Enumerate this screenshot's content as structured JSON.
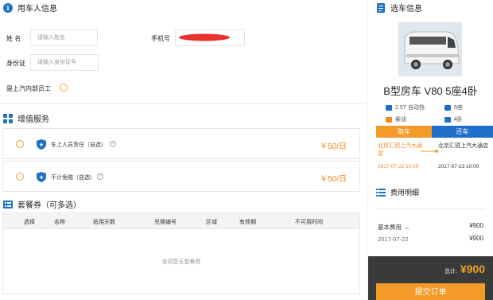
{
  "user_info": {
    "title": "用车人信息",
    "name_label": "姓  名",
    "name_placeholder": "请输入姓名",
    "phone_label": "手机号",
    "id_label": "身份证",
    "id_placeholder": "请输入身份证号",
    "employee_label": "是上汽内部员工"
  },
  "value_added": {
    "title": "增值服务",
    "items": [
      {
        "name": "车上人员责任（自选）",
        "price": "￥50/日"
      },
      {
        "name": "不计免赔（自选）",
        "price": "￥50/日"
      }
    ]
  },
  "coupons": {
    "title": "套餐券（可多选）",
    "columns": [
      "选择",
      "名称",
      "抵用天数",
      "兑换编号",
      "区域",
      "有效期",
      "不可用时间"
    ],
    "empty_text": "该项暂无套餐券"
  },
  "car": {
    "section_title": "选车信息",
    "name": "B型房车 V80 5座4卧",
    "specs": {
      "engine": "2.5T 自动挡",
      "seats": "5座",
      "fuel": "柴油",
      "beds": "4卧"
    },
    "pickup_tab": "取车",
    "return_tab": "还车",
    "pickup_location": "北京汇锐上汽大通店",
    "return_location": "北京汇锐上汽大通店",
    "pickup_time": "2017-07-22 10:00",
    "return_time": "2017-07-23 10:00"
  },
  "fees": {
    "title": "费用明细",
    "base_label": "基本费用",
    "base_value": "¥900",
    "date_label": "2017-07-22",
    "date_value": "¥900",
    "total_label": "总计:",
    "total_value": "¥900",
    "submit_label": "提交订单"
  },
  "colors": {
    "accent": "#1d6fc9",
    "orange": "#f39a29",
    "dark": "#3a3a3a"
  }
}
